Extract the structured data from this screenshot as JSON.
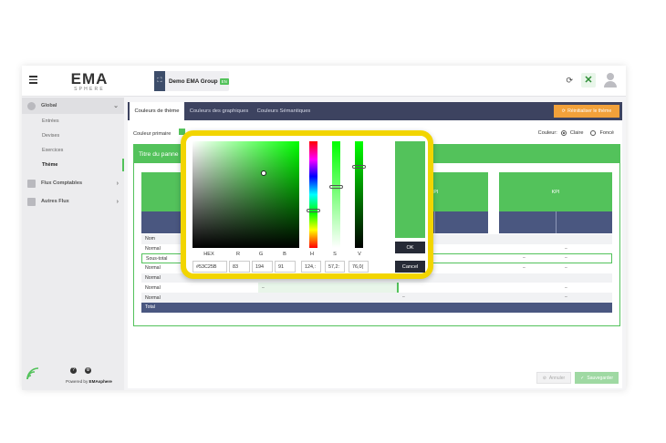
{
  "header": {
    "logo_main": "EMA",
    "logo_sub": "SPHERE",
    "company_name": "Demo EMA Group",
    "company_badge": "EN"
  },
  "sidebar": {
    "groups": [
      {
        "label": "Global",
        "items": [
          "Entrées",
          "Devises",
          "Exercices",
          "Thème"
        ],
        "active_item": "Thème"
      },
      {
        "label": "Flux Comptables"
      },
      {
        "label": "Autres Flux"
      }
    ],
    "powered_by_prefix": "Powered by",
    "powered_by_brand": "EMAsphere"
  },
  "tabs": {
    "items": [
      "Couleurs de thème",
      "Couleurs des graphiques",
      "Couleurs Sémantiques"
    ],
    "active": "Couleurs de thème",
    "reset_label": "Réinitialiser le thème"
  },
  "settings": {
    "primary_color_label": "Couleur primaire",
    "primary_color": "#53C25B",
    "mode_label": "Couleur:",
    "mode_options": [
      "Claire",
      "Foncé"
    ],
    "mode_selected": "Claire"
  },
  "preview_panel": {
    "title": "Titre du panne",
    "kpi_label": "KPI",
    "rows": [
      "Nom",
      "Normal",
      "Sous-total",
      "Normal",
      "Normal",
      "Normal",
      "Normal",
      "Total"
    ],
    "dash": "–"
  },
  "footer": {
    "cancel_label": "Annuler",
    "save_label": "Sauvegarder"
  },
  "color_picker": {
    "labels": {
      "hex": "HEX",
      "r": "R",
      "g": "G",
      "b": "B",
      "h": "H",
      "s": "S",
      "v": "V"
    },
    "values": {
      "hex": "#53C25B",
      "r": "83",
      "g": "194",
      "b": "91",
      "h": "124,:",
      "s": "57,2:",
      "v": "76,0("
    },
    "ok_label": "OK",
    "cancel_label": "Cancel"
  },
  "colors": {
    "accent_green": "#53C25B",
    "navy": "#3D4360",
    "orange": "#F2A13A",
    "highlight_yellow": "#F2D500"
  }
}
